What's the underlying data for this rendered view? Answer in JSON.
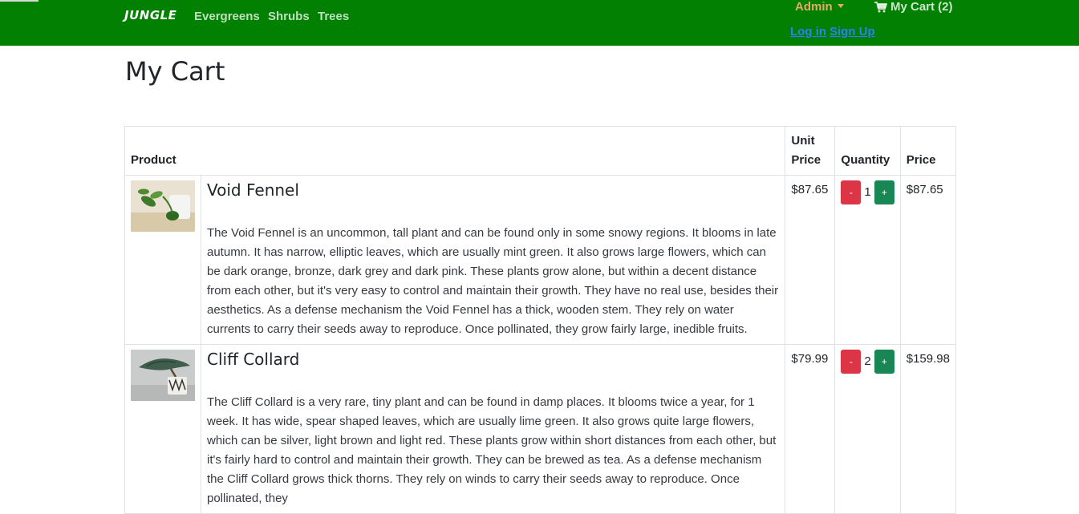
{
  "nav": {
    "brand": "JUNGLE",
    "links": [
      "Evergreens",
      "Shrubs",
      "Trees"
    ],
    "admin_label": "Admin",
    "cart_label": "My Cart (2)",
    "login_label": "Log in",
    "signup_label": "Sign Up"
  },
  "page": {
    "title": "My Cart"
  },
  "table": {
    "headers": {
      "product": "Product",
      "unit_price_line1": "Unit",
      "unit_price_line2": "Price",
      "quantity": "Quantity",
      "price": "Price"
    },
    "rows": [
      {
        "name": "Void Fennel",
        "description": "The Void Fennel is an uncommon, tall plant and can be found only in some snowy regions. It blooms in late autumn. It has narrow, elliptic leaves, which are usually mint green. It also grows large flowers, which can be dark orange, bronze, dark grey and dark pink. These plants grow alone, but within a decent distance from each other, but it's very easy to control and maintain their growth. They have no real use, besides their aesthetics. As a defense mechanism the Void Fennel has a thick, wooden stem. They rely on water currents to carry their seeds away to reproduce. Once pollinated, they grow fairly large, inedible fruits.",
        "unit_price": "$87.65",
        "quantity": "1",
        "price": "$87.65"
      },
      {
        "name": "Cliff Collard",
        "description": "The Cliff Collard is a very rare, tiny plant and can be found in damp places. It blooms twice a year, for 1 week. It has wide, spear shaped leaves, which are usually lime green. It also grows quite large flowers, which can be silver, light brown and light red. These plants grow within short distances from each other, but it's fairly hard to control and maintain their growth. They can be brewed as tea. As a defense mechanism the Cliff Collard grows thick thorns. They rely on winds to carry their seeds away to reproduce. Once pollinated, they",
        "unit_price": "$79.99",
        "quantity": "2",
        "price": "$159.98"
      }
    ],
    "minus_label": "-",
    "plus_label": "+"
  },
  "colors": {
    "nav_bg": "#018001",
    "minus_button": "#dc3545",
    "plus_button": "#198754",
    "link": "#2d7ff9"
  },
  "icons": [
    "cart-icon",
    "caret-down-icon",
    "plant-thumbnail"
  ]
}
